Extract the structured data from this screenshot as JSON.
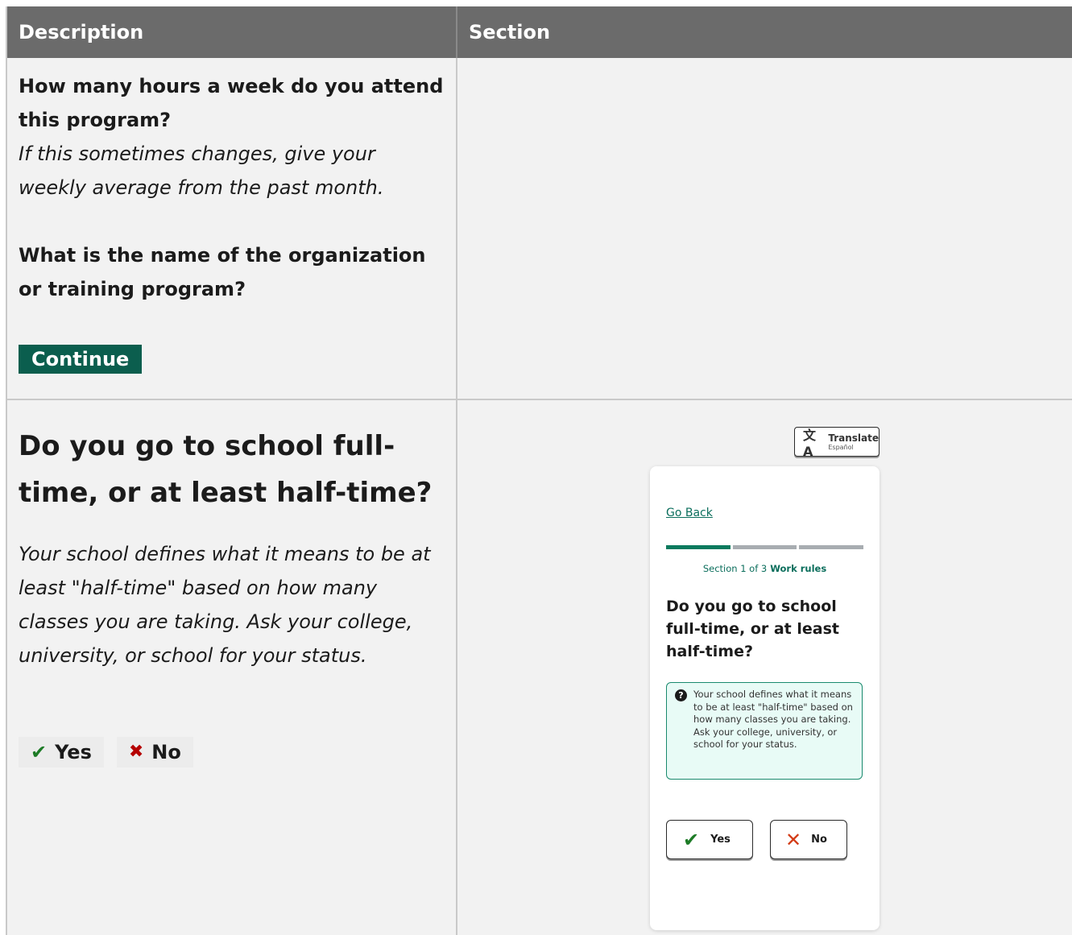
{
  "table": {
    "headers": {
      "description": "Description",
      "section": "Section"
    },
    "row1": {
      "question_hours": "How many hours a week do you attend this program?",
      "hint_hours": "If this sometimes changes, give your weekly average from the past month.",
      "question_org": "What is the name of the organization or training program?",
      "continue_label": "Continue"
    },
    "row2": {
      "question": "Do you go to school full-time, or at least half-time?",
      "hint": "Your school defines what it means to be at least \"half-time\" based on how many classes you are taking. Ask your college, university, or school for your status.",
      "yes_label": "Yes",
      "no_label": "No",
      "yes_icon": "check-icon",
      "no_icon": "x-icon"
    }
  },
  "phone": {
    "translate_label": "Translate",
    "translate_sub": "Español",
    "go_back": "Go Back",
    "progress_steps_total": 3,
    "progress_steps_done": 1,
    "section_prefix": "Section 1 of 3",
    "section_name": "Work rules",
    "question": "Do you go to school full-time, or at least half-time?",
    "hint": "Your school defines what it means to be at least \"half-time\" based on how many classes you are taking. Ask your college, university, or school for your status.",
    "yes_label": "Yes",
    "no_label": "No"
  },
  "colors": {
    "header_bg": "#6b6b6b",
    "continue_bg": "#0b5e4e",
    "accent_green": "#0b7a5e",
    "check_green": "#1d7b26",
    "no_red": "#d33b16",
    "hint_bg": "#e8fbf6"
  }
}
